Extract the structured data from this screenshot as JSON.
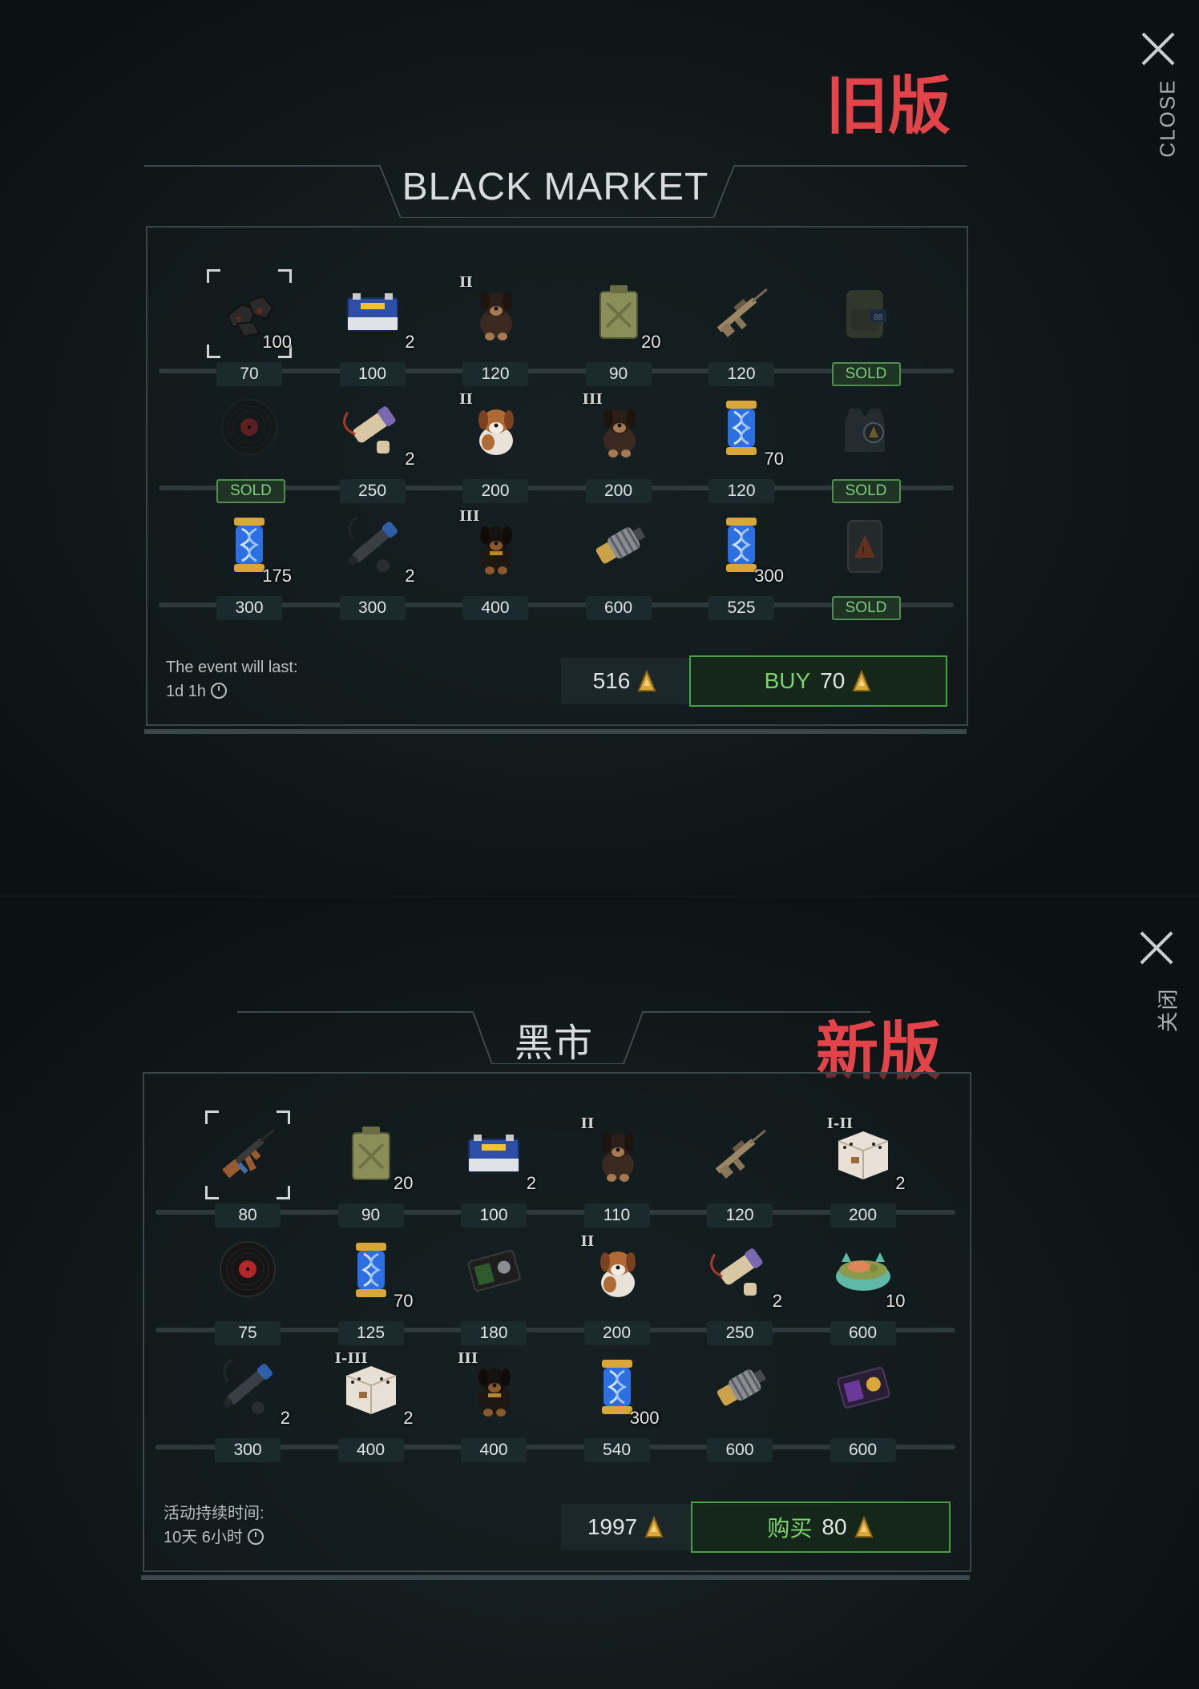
{
  "old": {
    "version_label": "旧版",
    "close_label": "CLOSE",
    "title": "BLACK MARKET",
    "event_label": "The event will last:",
    "event_time": "1d 1h",
    "balance": "516",
    "buy_label": "BUY",
    "buy_price": "70",
    "rows": [
      [
        {
          "icon": "coal-icon",
          "qty": "100",
          "tier": "",
          "price": "70",
          "sold": false,
          "selected": true
        },
        {
          "icon": "battery-icon",
          "qty": "2",
          "tier": "",
          "price": "100",
          "sold": false
        },
        {
          "icon": "puppy-icon",
          "qty": "",
          "tier": "II",
          "price": "120",
          "sold": false
        },
        {
          "icon": "jerrycan-icon",
          "qty": "20",
          "tier": "",
          "price": "90",
          "sold": false
        },
        {
          "icon": "rifle-icon",
          "qty": "",
          "tier": "",
          "price": "120",
          "sold": false
        },
        {
          "icon": "backpack-icon",
          "qty": "",
          "tier": "",
          "price": "SOLD",
          "sold": true
        }
      ],
      [
        {
          "icon": "vinyl-record-icon",
          "qty": "",
          "tier": "",
          "price": "SOLD",
          "sold": true
        },
        {
          "icon": "parchment-icon",
          "qty": "2",
          "tier": "",
          "price": "250",
          "sold": false
        },
        {
          "icon": "st-bernard-puppy-icon",
          "qty": "",
          "tier": "II",
          "price": "200",
          "sold": false
        },
        {
          "icon": "puppy-icon",
          "qty": "",
          "tier": "III",
          "price": "200",
          "sold": false
        },
        {
          "icon": "dna-capsule-icon",
          "qty": "70",
          "tier": "",
          "price": "120",
          "sold": false
        },
        {
          "icon": "armor-vest-icon",
          "qty": "",
          "tier": "",
          "price": "SOLD",
          "sold": true
        }
      ],
      [
        {
          "icon": "dna-capsule-icon",
          "qty": "175",
          "tier": "",
          "price": "300",
          "sold": false
        },
        {
          "icon": "scope-icon",
          "qty": "2",
          "tier": "",
          "price": "300",
          "sold": false
        },
        {
          "icon": "rottweiler-puppy-icon",
          "qty": "",
          "tier": "III",
          "price": "400",
          "sold": false
        },
        {
          "icon": "engine-part-icon",
          "qty": "",
          "tier": "",
          "price": "600",
          "sold": false
        },
        {
          "icon": "dna-capsule-icon",
          "qty": "300",
          "tier": "",
          "price": "525",
          "sold": false
        },
        {
          "icon": "toolkit-case-icon",
          "qty": "",
          "tier": "",
          "price": "SOLD",
          "sold": true
        }
      ]
    ]
  },
  "new": {
    "version_label": "新版",
    "close_label": "关闭",
    "title": "黑市",
    "event_label": "活动持续时间:",
    "event_time": "10天 6小时",
    "balance": "1997",
    "buy_label": "购买",
    "buy_price": "80",
    "rows": [
      [
        {
          "icon": "ak-rifle-icon",
          "qty": "",
          "tier": "",
          "price": "80",
          "sold": false,
          "selected": true
        },
        {
          "icon": "jerrycan-icon",
          "qty": "20",
          "tier": "",
          "price": "90",
          "sold": false
        },
        {
          "icon": "battery-icon",
          "qty": "2",
          "tier": "",
          "price": "100",
          "sold": false
        },
        {
          "icon": "puppy-icon",
          "qty": "",
          "tier": "II",
          "price": "110",
          "sold": false
        },
        {
          "icon": "rifle-icon",
          "qty": "",
          "tier": "",
          "price": "120",
          "sold": false
        },
        {
          "icon": "pet-box-icon",
          "qty": "2",
          "tier": "I-II",
          "price": "200",
          "sold": false
        }
      ],
      [
        {
          "icon": "vinyl-record-icon",
          "qty": "",
          "tier": "",
          "price": "75",
          "sold": false
        },
        {
          "icon": "dna-capsule-icon",
          "qty": "70",
          "tier": "",
          "price": "125",
          "sold": false
        },
        {
          "icon": "wallet-icon",
          "qty": "",
          "tier": "",
          "price": "180",
          "sold": false
        },
        {
          "icon": "st-bernard-puppy-icon",
          "qty": "",
          "tier": "II",
          "price": "200",
          "sold": false
        },
        {
          "icon": "parchment-icon",
          "qty": "2",
          "tier": "",
          "price": "250",
          "sold": false
        },
        {
          "icon": "pet-food-bowl-icon",
          "qty": "10",
          "tier": "",
          "price": "600",
          "sold": false
        }
      ],
      [
        {
          "icon": "scope-icon",
          "qty": "2",
          "tier": "",
          "price": "300",
          "sold": false
        },
        {
          "icon": "pet-box-icon",
          "qty": "2",
          "tier": "I-III",
          "price": "400",
          "sold": false
        },
        {
          "icon": "rottweiler-puppy-icon",
          "qty": "",
          "tier": "III",
          "price": "400",
          "sold": false
        },
        {
          "icon": "dna-capsule-icon",
          "qty": "300",
          "tier": "",
          "price": "540",
          "sold": false
        },
        {
          "icon": "engine-part-icon",
          "qty": "",
          "tier": "",
          "price": "600",
          "sold": false
        },
        {
          "icon": "badge-wallet-icon",
          "qty": "",
          "tier": "",
          "price": "600",
          "sold": false
        }
      ]
    ]
  }
}
